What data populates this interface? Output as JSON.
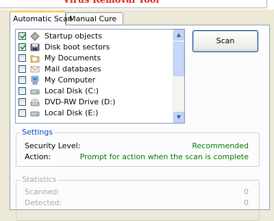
{
  "app": {
    "title": "Virus Removal Tool"
  },
  "tabs": [
    {
      "label": "Automatic Scan",
      "active": true
    },
    {
      "label": "Manual Cure",
      "active": false
    }
  ],
  "scan_objects": [
    {
      "label": "Startup objects",
      "checked": true,
      "icon": "gear-icon"
    },
    {
      "label": "Disk boot sectors",
      "checked": true,
      "icon": "disk-boot-icon"
    },
    {
      "label": "My Documents",
      "checked": false,
      "icon": "folder-icon"
    },
    {
      "label": "Mail databases",
      "checked": false,
      "icon": "mail-icon"
    },
    {
      "label": "My Computer",
      "checked": false,
      "icon": "computer-icon"
    },
    {
      "label": "Local Disk (C:)",
      "checked": false,
      "icon": "hard-drive-icon"
    },
    {
      "label": "DVD-RW Drive (D:)",
      "checked": false,
      "icon": "dvd-drive-icon"
    },
    {
      "label": "Local Disk (E:)",
      "checked": false,
      "icon": "hard-drive-icon"
    }
  ],
  "scan_button": {
    "label": "Scan"
  },
  "settings": {
    "title": "Settings",
    "security_level_label": "Security Level:",
    "security_level_value": "Recommended",
    "action_label": "Action:",
    "action_value": "Prompt for action when the scan is complete"
  },
  "statistics": {
    "title": "Statistics",
    "scanned_label": "Scanned:",
    "scanned_value": "0",
    "detected_label": "Detected:",
    "detected_value": "0"
  },
  "colors": {
    "title_red": "#e02020",
    "group_title_blue": "#0046d5",
    "value_green": "#007a00",
    "disabled_gray": "#aca899"
  }
}
